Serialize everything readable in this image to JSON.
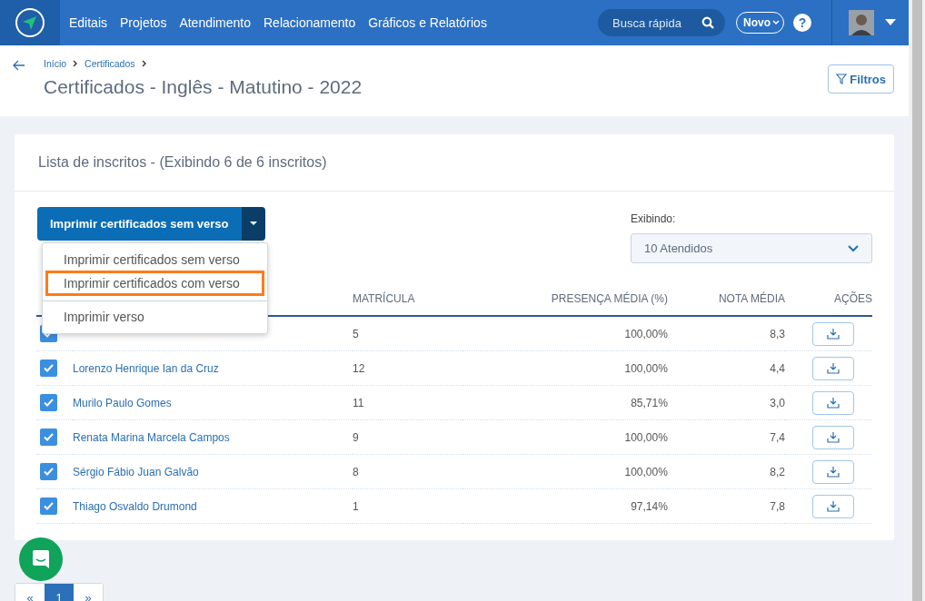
{
  "nav": {
    "items": [
      "Editais",
      "Projetos",
      "Atendimento",
      "Relacionamento",
      "Gráficos e Relatórios"
    ],
    "search": {
      "placeholder": "Busca rápida"
    },
    "new_button": "Novo",
    "help": "?"
  },
  "header": {
    "breadcrumb": [
      "Início",
      "Certificados"
    ],
    "title": "Certificados - Inglês - Matutino - 2022",
    "filter_button": "Filtros"
  },
  "card": {
    "title": "Lista de inscritos - (Exibindo 6 de 6 inscritos)",
    "print_button": "Imprimir certificados sem verso",
    "menu": [
      {
        "label": "Imprimir certificados sem verso",
        "selected": false,
        "divider_before": false
      },
      {
        "label": "Imprimir certificados com verso",
        "selected": true,
        "divider_before": false
      },
      {
        "label": "Imprimir verso",
        "selected": false,
        "divider_before": true
      }
    ],
    "filter": {
      "label": "Exibindo:",
      "value": "10 Atendidos"
    },
    "columns": [
      "MATRÍCULA",
      "PRESENÇA MÉDIA (%)",
      "NOTA MÉDIA",
      "AÇÕES"
    ],
    "rows": [
      {
        "checked": true,
        "name": "",
        "enrollment": "5",
        "attendance": "100,00%",
        "grade": "8,3"
      },
      {
        "checked": true,
        "name": "Lorenzo Henrique Ian da Cruz",
        "enrollment": "12",
        "attendance": "100,00%",
        "grade": "4,4"
      },
      {
        "checked": true,
        "name": "Murilo Paulo Gomes",
        "enrollment": "11",
        "attendance": "85,71%",
        "grade": "3,0"
      },
      {
        "checked": true,
        "name": "Renata Marina Marcela Campos",
        "enrollment": "9",
        "attendance": "100,00%",
        "grade": "7,4"
      },
      {
        "checked": true,
        "name": "Sérgio Fábio Juan Galvão",
        "enrollment": "8",
        "attendance": "100,00%",
        "grade": "8,2"
      },
      {
        "checked": true,
        "name": "Thiago Osvaldo Drumond",
        "enrollment": "1",
        "attendance": "97,14%",
        "grade": "7,8"
      }
    ]
  },
  "pagination": [
    {
      "label": "«",
      "selected": false
    },
    {
      "label": "1",
      "selected": true
    },
    {
      "label": "»",
      "selected": false
    }
  ]
}
